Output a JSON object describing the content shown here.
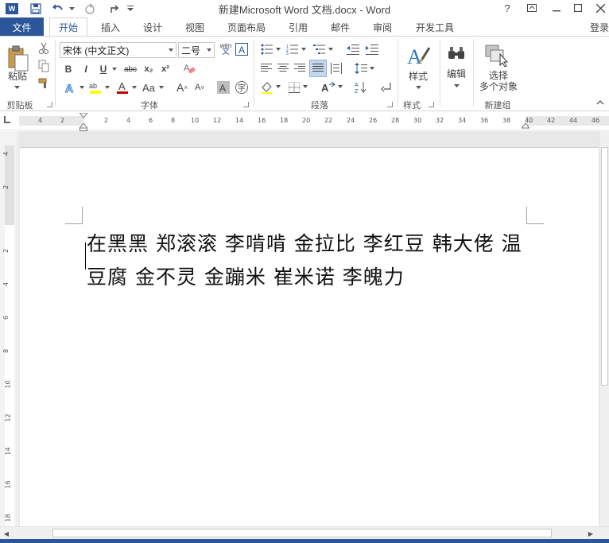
{
  "titlebar": {
    "title": "新建Microsoft Word 文档.docx - Word",
    "help": "?",
    "ribbon_opts": "⊡",
    "minimize": "—",
    "maximize": "☐",
    "close": "✕"
  },
  "tabs": {
    "file": "文件",
    "items": [
      "开始",
      "插入",
      "设计",
      "视图",
      "页面布局",
      "引用",
      "邮件",
      "审阅",
      "开发工具"
    ],
    "login": "登录"
  },
  "ribbon": {
    "clipboard": {
      "paste": "粘贴",
      "label": "剪贴板"
    },
    "font": {
      "font_name": "宋体 (中文正文)",
      "font_size": "二号",
      "bold": "B",
      "italic": "I",
      "underline": "U",
      "strike": "abc",
      "subscript": "x₂",
      "superscript": "x²",
      "font_color": "A",
      "change_case": "Aa",
      "grow": "A",
      "shrink": "A",
      "phonetic": "wén",
      "label": "字体"
    },
    "paragraph": {
      "label": "段落"
    },
    "styles": {
      "button": "样式",
      "label": "样式"
    },
    "editing": {
      "button": "编辑"
    },
    "newgroup": {
      "button_line1": "选择",
      "button_line2": "多个对象",
      "label": "新建组"
    }
  },
  "ruler": {
    "left_numbers": [
      "4",
      "2"
    ],
    "right_numbers": [
      "2",
      "4",
      "6",
      "8",
      "10",
      "12",
      "14",
      "16",
      "18",
      "20",
      "22",
      "24",
      "26",
      "28",
      "30",
      "32",
      "34",
      "36",
      "38",
      "40",
      "42",
      "44",
      "46"
    ],
    "vertical_numbers": [
      "4",
      "2",
      "2",
      "4",
      "6",
      "8",
      "10",
      "12",
      "14",
      "16",
      "18"
    ]
  },
  "document": {
    "text": "在黑黑  郑滚滚  李啃啃  金拉比  李红豆  韩大佬  温豆腐  金不灵  金蹦米  崔米诺  李魄力"
  },
  "colors": {
    "accent": "#2b579a",
    "background": "#e8e8e8"
  }
}
